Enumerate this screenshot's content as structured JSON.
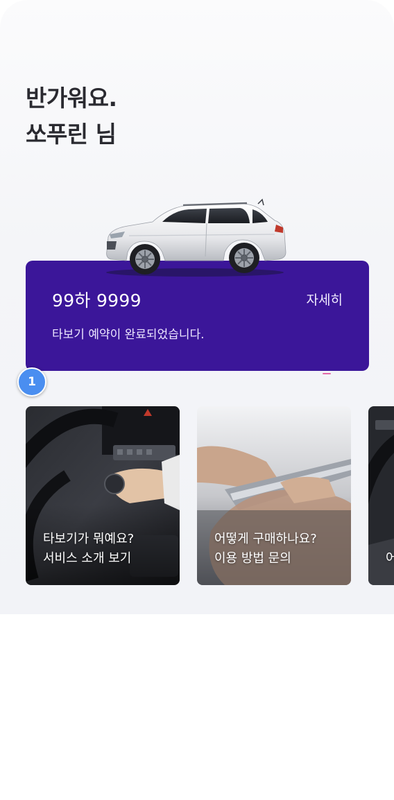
{
  "greeting": {
    "line1": "반가워요.",
    "line2": "쏘푸린 님"
  },
  "vehicle_card": {
    "plate_number": "99하 9999",
    "detail_label": "자세히",
    "status_text": "타보기 예약이 완료되었습니다.",
    "background_color": "#3b1699"
  },
  "step_badge": {
    "number": "1",
    "color": "#4a8ef0"
  },
  "tiles": [
    {
      "line1": "타보기가 뭐예요?",
      "line2": "서비스 소개 보기",
      "icon": "steering-wheel-photo"
    },
    {
      "line1": "어떻게 구매하나요?",
      "line2": "이용 방법 문의",
      "icon": "phone-in-hand-photo"
    },
    {
      "line1": "어",
      "line2": "",
      "icon": "steering-wheel-photo"
    }
  ]
}
